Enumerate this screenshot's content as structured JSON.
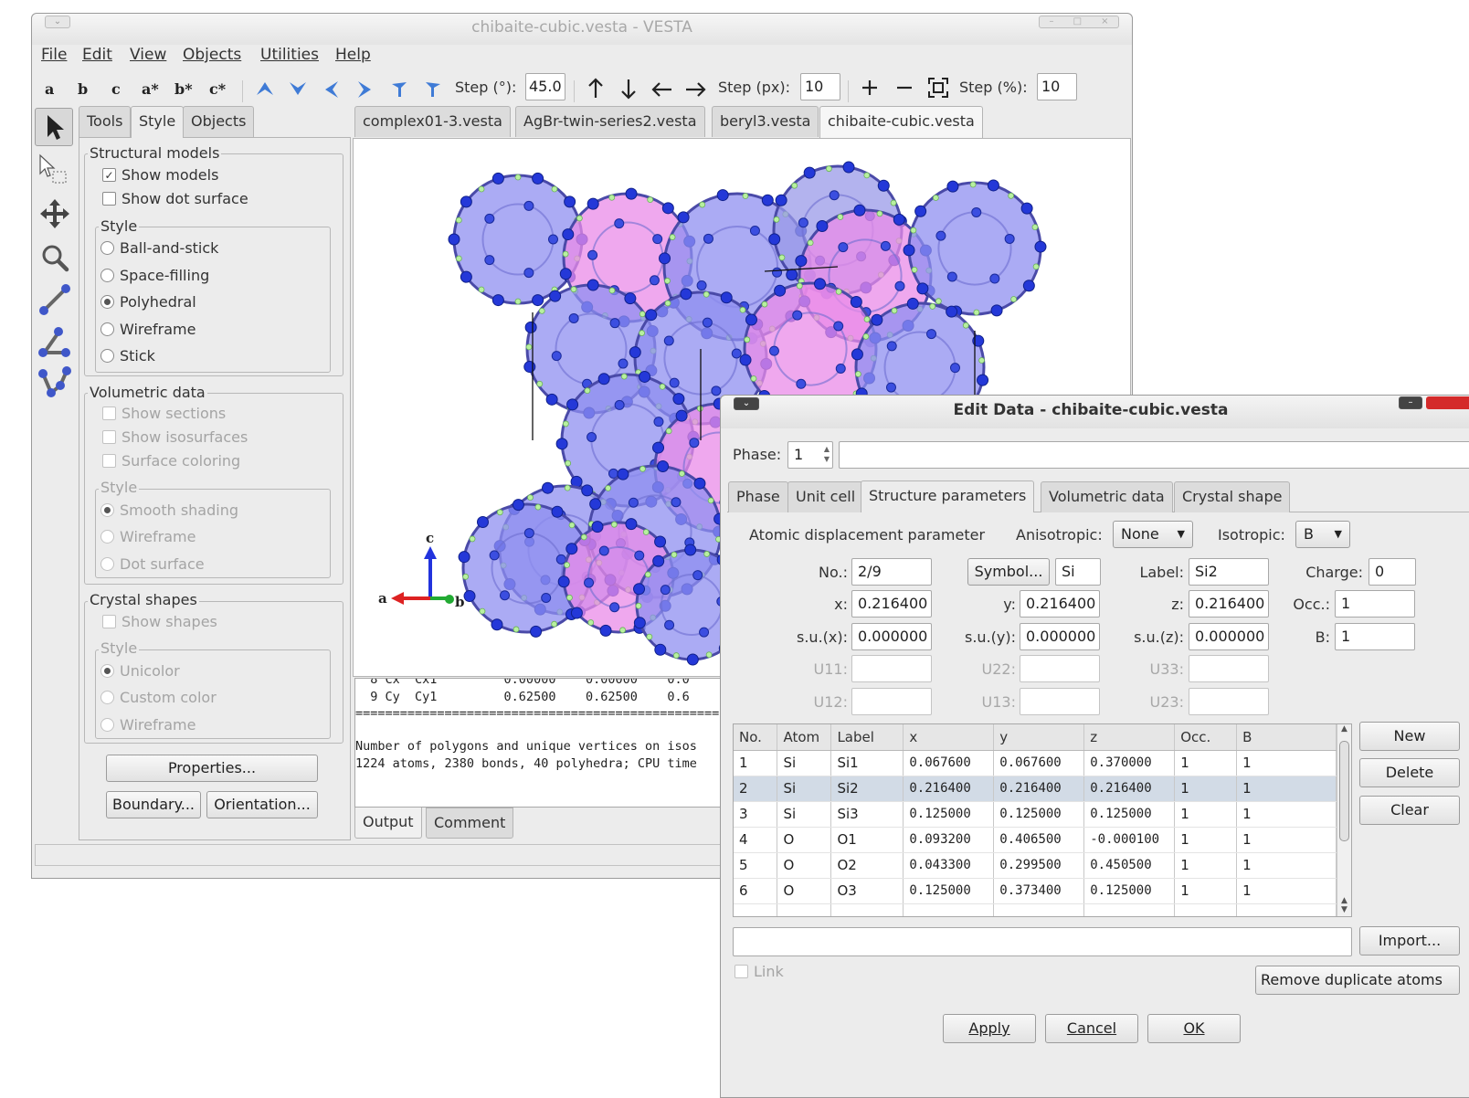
{
  "main_window": {
    "title": "chibaite-cubic.vesta - VESTA",
    "menu": [
      "File",
      "Edit",
      "View",
      "Objects",
      "Utilities",
      "Help"
    ],
    "toolbar": {
      "axis_buttons": [
        "a",
        "b",
        "c",
        "a*",
        "b*",
        "c*"
      ],
      "step_deg_label": "Step (°):",
      "step_deg_value": "45.0",
      "step_px_label": "Step (px):",
      "step_px_value": "10",
      "step_pct_label": "Step (%):",
      "step_pct_value": "10"
    },
    "panel_tabs": [
      "Tools",
      "Style",
      "Objects"
    ],
    "structural_models": {
      "legend": "Structural models",
      "show_models": "Show models",
      "show_dot_surface": "Show dot surface",
      "style_legend": "Style",
      "styles": [
        "Ball-and-stick",
        "Space-filling",
        "Polyhedral",
        "Wireframe",
        "Stick"
      ],
      "selected": "Polyhedral"
    },
    "volumetric": {
      "legend": "Volumetric data",
      "options": [
        "Show sections",
        "Show isosurfaces",
        "Surface coloring"
      ],
      "style_legend": "Style",
      "styles": [
        "Smooth shading",
        "Wireframe",
        "Dot surface"
      ]
    },
    "crystal_shapes": {
      "legend": "Crystal shapes",
      "show_shapes": "Show shapes",
      "style_legend": "Style",
      "styles": [
        "Unicolor",
        "Custom color",
        "Wireframe"
      ]
    },
    "buttons": {
      "properties": "Properties...",
      "boundary": "Boundary...",
      "orientation": "Orientation..."
    },
    "file_tabs": [
      "complex01-3.vesta",
      "AgBr-twin-series2.vesta",
      "beryl3.vesta",
      "chibaite-cubic.vesta"
    ],
    "axes_labels": {
      "a": "a",
      "b": "b",
      "c": "c"
    },
    "output": {
      "lines": [
        "  8 Cx  Cx1         0.00000    0.00000    0.0",
        "  9 Cy  Cy1         0.62500    0.62500    0.6",
        "=================================================",
        "",
        "Number of polygons and unique vertices on isos",
        "1224 atoms, 2380 bonds, 40 polyhedra; CPU time"
      ],
      "tabs": [
        "Output",
        "Comment"
      ]
    }
  },
  "dialog": {
    "title": "Edit Data - chibaite-cubic.vesta",
    "phase_label": "Phase:",
    "phase_value": "1",
    "tabs": [
      "Phase",
      "Unit cell",
      "Structure parameters",
      "Volumetric data",
      "Crystal shape"
    ],
    "adp_label": "Atomic displacement parameter",
    "anisotropic_label": "Anisotropic:",
    "anisotropic_value": "None",
    "isotropic_label": "Isotropic:",
    "isotropic_value": "B",
    "fields": {
      "no_label": "No.:",
      "no_value": "2/9",
      "symbol_button": "Symbol...",
      "symbol_value": "Si",
      "label_label": "Label:",
      "label_value": "Si2",
      "charge_label": "Charge:",
      "charge_value": "0",
      "x_label": "x:",
      "x_value": "0.216400",
      "y_label": "y:",
      "y_value": "0.216400",
      "z_label": "z:",
      "z_value": "0.216400",
      "occ_label": "Occ.:",
      "occ_value": "1",
      "sux_label": "s.u.(x):",
      "sux_value": "0.000000",
      "suy_label": "s.u.(y):",
      "suy_value": "0.000000",
      "suz_label": "s.u.(z):",
      "suz_value": "0.000000",
      "b_label": "B:",
      "b_value": "1",
      "u11": "U11:",
      "u22": "U22:",
      "u33": "U33:",
      "u12": "U12:",
      "u13": "U13:",
      "u23": "U23:"
    },
    "table": {
      "headers": [
        "No.",
        "Atom",
        "Label",
        "x",
        "y",
        "z",
        "Occ.",
        "B"
      ],
      "rows": [
        [
          "1",
          "Si",
          "Si1",
          "0.067600",
          "0.067600",
          "0.370000",
          "1",
          "1"
        ],
        [
          "2",
          "Si",
          "Si2",
          "0.216400",
          "0.216400",
          "0.216400",
          "1",
          "1"
        ],
        [
          "3",
          "Si",
          "Si3",
          "0.125000",
          "0.125000",
          "0.125000",
          "1",
          "1"
        ],
        [
          "4",
          "O",
          "O1",
          "0.093200",
          "0.406500",
          "-0.000100",
          "1",
          "1"
        ],
        [
          "5",
          "O",
          "O2",
          "0.043300",
          "0.299500",
          "0.450500",
          "1",
          "1"
        ],
        [
          "6",
          "O",
          "O3",
          "0.125000",
          "0.373400",
          "0.125000",
          "1",
          "1"
        ]
      ],
      "selected_index": 1
    },
    "side_buttons": [
      "New",
      "Delete",
      "Clear"
    ],
    "import_button": "Import...",
    "link_label": "Link",
    "remove_dup_button": "Remove duplicate atoms",
    "apply": "Apply",
    "cancel": "Cancel",
    "ok": "OK"
  }
}
